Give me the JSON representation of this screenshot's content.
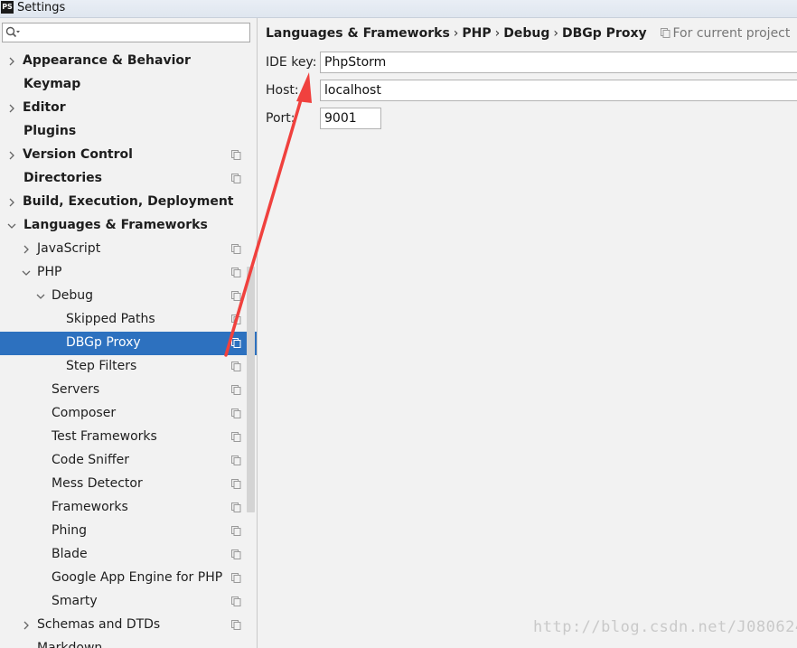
{
  "window": {
    "title": "Settings",
    "app_icon": "PS"
  },
  "search": {
    "placeholder": "",
    "value": ""
  },
  "tree": [
    {
      "label": "Appearance & Behavior",
      "bold": true,
      "chevron": "right",
      "project": false
    },
    {
      "label": "Keymap",
      "bold": true,
      "chevron": "none",
      "project": false
    },
    {
      "label": "Editor",
      "bold": true,
      "chevron": "right",
      "project": false
    },
    {
      "label": "Plugins",
      "bold": true,
      "chevron": "none",
      "project": false
    },
    {
      "label": "Version Control",
      "bold": true,
      "chevron": "right",
      "project": true
    },
    {
      "label": "Directories",
      "bold": true,
      "chevron": "none",
      "project": true
    },
    {
      "label": "Build, Execution, Deployment",
      "bold": true,
      "chevron": "right",
      "project": false
    },
    {
      "label": "Languages & Frameworks",
      "bold": true,
      "chevron": "down",
      "project": false
    },
    {
      "label": "JavaScript",
      "bold": false,
      "chevron": "right",
      "project": true
    },
    {
      "label": "PHP",
      "bold": false,
      "chevron": "down",
      "project": true
    },
    {
      "label": "Debug",
      "bold": false,
      "chevron": "down",
      "project": true
    },
    {
      "label": "Skipped Paths",
      "bold": false,
      "chevron": "none",
      "project": true
    },
    {
      "label": "DBGp Proxy",
      "bold": false,
      "chevron": "none",
      "project": true,
      "selected": true
    },
    {
      "label": "Step Filters",
      "bold": false,
      "chevron": "none",
      "project": true
    },
    {
      "label": "Servers",
      "bold": false,
      "chevron": "none",
      "project": true
    },
    {
      "label": "Composer",
      "bold": false,
      "chevron": "none",
      "project": true
    },
    {
      "label": "Test Frameworks",
      "bold": false,
      "chevron": "none",
      "project": true
    },
    {
      "label": "Code Sniffer",
      "bold": false,
      "chevron": "none",
      "project": true
    },
    {
      "label": "Mess Detector",
      "bold": false,
      "chevron": "none",
      "project": true
    },
    {
      "label": "Frameworks",
      "bold": false,
      "chevron": "none",
      "project": true
    },
    {
      "label": "Phing",
      "bold": false,
      "chevron": "none",
      "project": true
    },
    {
      "label": "Blade",
      "bold": false,
      "chevron": "none",
      "project": true
    },
    {
      "label": "Google App Engine for PHP",
      "bold": false,
      "chevron": "none",
      "project": true
    },
    {
      "label": "Smarty",
      "bold": false,
      "chevron": "none",
      "project": true
    },
    {
      "label": "Schemas and DTDs",
      "bold": false,
      "chevron": "right",
      "project": true
    },
    {
      "label": "Markdown",
      "bold": false,
      "chevron": "none",
      "project": false
    }
  ],
  "breadcrumb": {
    "items": [
      "Languages & Frameworks",
      "PHP",
      "Debug",
      "DBGp Proxy"
    ],
    "separator": "›",
    "project_note": "For current project"
  },
  "form": {
    "ide_key_label": "IDE key:",
    "ide_key_value": "PhpStorm",
    "host_label": "Host:",
    "host_value": "localhost",
    "port_label": "Port:",
    "port_value": "9001"
  },
  "watermark": "http://blog.csdn.net/J080624",
  "colors": {
    "selection": "#2d71bf",
    "arrow": "#f0413e",
    "panel": "#f2f2f2"
  }
}
